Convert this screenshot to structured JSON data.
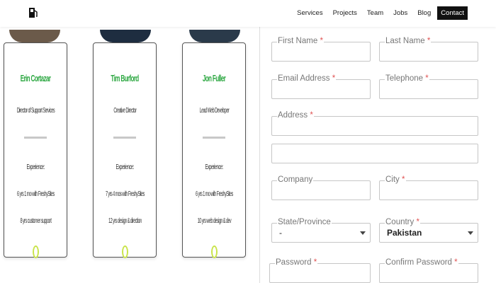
{
  "nav": {
    "logo_icon": "gas-pump-icon",
    "items": [
      "Services",
      "Projects",
      "Team",
      "Jobs",
      "Blog",
      "Contact"
    ],
    "active": "Contact"
  },
  "team": [
    {
      "name": "Erin Cortazar",
      "role": "Director of Support Services",
      "experience_label": "Experience:",
      "line1": "6 yrs 1 mo with FreshySites",
      "line2": "8 yrs customer support"
    },
    {
      "name": "Tim Burford",
      "role": "Creative Director",
      "experience_label": "Experience:",
      "line1": "7 yrs 4 mos with FreshySites",
      "line2": "12 yrs design & direction"
    },
    {
      "name": "Jon Fuller",
      "role": "Lead Web Developer",
      "experience_label": "Experience:",
      "line1": "6 yrs 1 mo with FreshySites",
      "line2": "10 yrs web design & dev"
    }
  ],
  "form": {
    "first_name": {
      "label": "First Name",
      "req": "*"
    },
    "last_name": {
      "label": "Last Name",
      "req": "*"
    },
    "email": {
      "label": "Email Address",
      "req": "*"
    },
    "telephone": {
      "label": "Telephone",
      "req": "*"
    },
    "address": {
      "label": "Address",
      "req": "*"
    },
    "company": {
      "label": "Company"
    },
    "city": {
      "label": "City",
      "req": "*"
    },
    "state": {
      "label": "State/Province",
      "value": "-"
    },
    "country": {
      "label": "Country",
      "req": "*",
      "value": "Pakistan"
    },
    "password": {
      "label": "Password",
      "req": "*"
    },
    "confirm_password": {
      "label": "Confirm Password",
      "req": "*"
    }
  },
  "colors": {
    "name_green": "#2ea843",
    "required_red": "#e05252",
    "nav_active_bg": "#111111"
  }
}
